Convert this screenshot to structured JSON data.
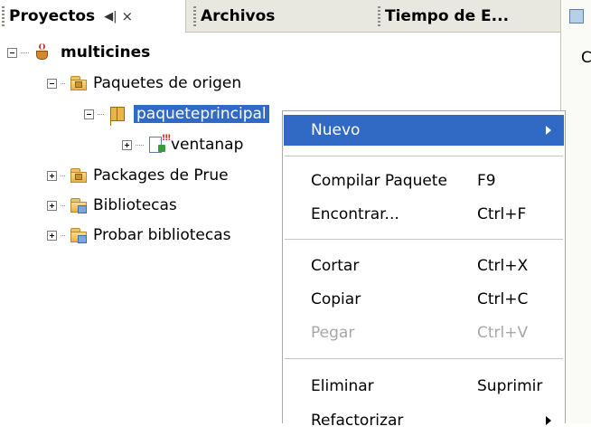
{
  "tabs": [
    {
      "label": "Proyectos",
      "active": true,
      "controls": [
        "◀|",
        "×"
      ]
    },
    {
      "label": "Archivos"
    },
    {
      "label": "Tiempo de E..."
    }
  ],
  "right_panel": {
    "text": "C"
  },
  "tree": {
    "root": {
      "label": "multicines",
      "icon": "coffee-cup-icon"
    },
    "items": [
      {
        "label": "Paquetes de origen",
        "icon": "folder-package-icon"
      },
      {
        "label": "paqueteprincipal",
        "icon": "package-icon",
        "selected": true
      },
      {
        "label": "ventanap",
        "icon": "java-form-file-icon"
      },
      {
        "label": "Packages de Prue",
        "icon": "folder-package-icon"
      },
      {
        "label": "Bibliotecas",
        "icon": "folder-library-icon"
      },
      {
        "label": "Probar bibliotecas",
        "icon": "folder-library-icon"
      }
    ]
  },
  "context_menu": {
    "items": [
      {
        "label": "Nuevo",
        "submenu": true,
        "highlighted": true
      },
      {
        "label": "Compilar Paquete",
        "shortcut": "F9"
      },
      {
        "label": "Encontrar...",
        "shortcut": "Ctrl+F"
      },
      {
        "label": "Cortar",
        "shortcut": "Ctrl+X"
      },
      {
        "label": "Copiar",
        "shortcut": "Ctrl+C"
      },
      {
        "label": "Pegar",
        "shortcut": "Ctrl+V",
        "disabled": true
      },
      {
        "label": "Eliminar",
        "shortcut": "Suprimir"
      },
      {
        "label": "Refactorizar",
        "submenu": true
      }
    ]
  },
  "colors": {
    "selection": "#316ac5",
    "tab_strip": "#e9e8e0",
    "disabled_text": "#a7a6aa"
  }
}
